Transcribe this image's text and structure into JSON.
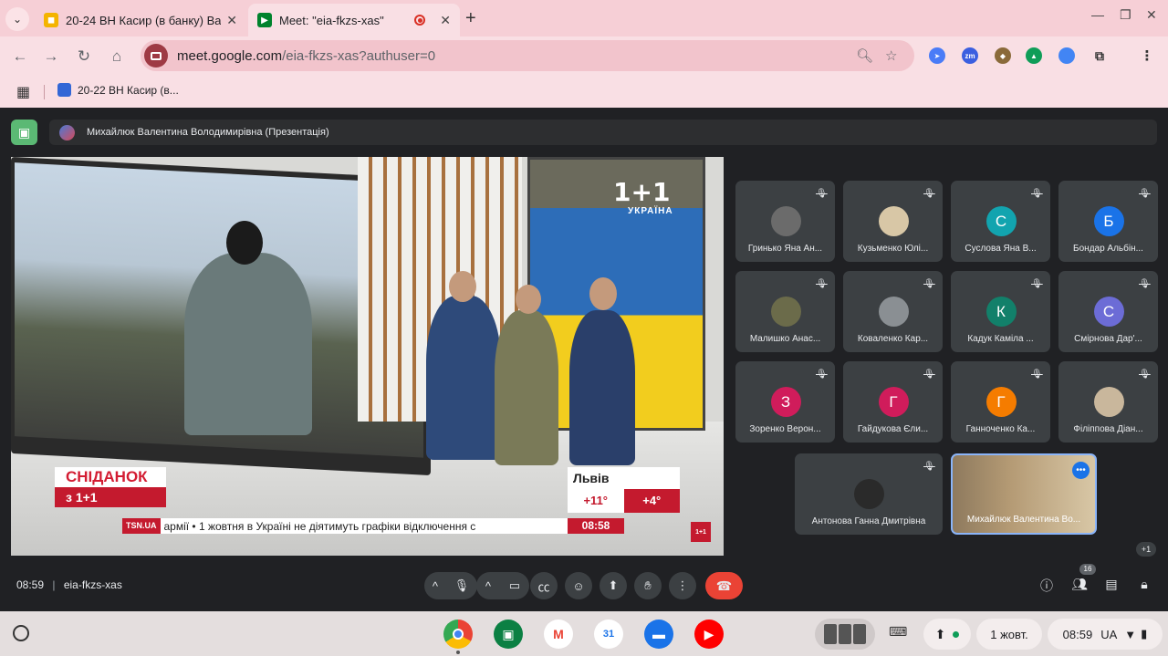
{
  "browser": {
    "tabs": [
      {
        "title": "20-24 ВН Касир (в банку) Вал",
        "active": false
      },
      {
        "title": "Meet: \"eia-fkzs-xas\"",
        "active": true
      }
    ],
    "url_host": "meet.google.com",
    "url_path": "/eia-fkzs-xas?authuser=0",
    "bookmark": "20-22 ВН Касир (в..."
  },
  "meet": {
    "presenter_banner": "Михайлюк Валентина Володимирівна (Презентація)",
    "broadcast": {
      "channel_logo": "1+1",
      "channel_sub": "УКРАЇНА",
      "show_name": "СНІДАНОК",
      "show_sub": "з 1+1",
      "city": "Львів",
      "temp1": "+11°",
      "temp2": "+4°",
      "ticker_source": "TSN.UA",
      "ticker_text": "армії • 1 жовтня в Україні не діятимуть графіки відключення с",
      "ticker_time": "08:58"
    },
    "participants": [
      {
        "name": "Гринько Яна Ан...",
        "initial": "",
        "color": "#6b6b6b"
      },
      {
        "name": "Кузьменко Юлі...",
        "initial": "",
        "color": "#d8c7a6"
      },
      {
        "name": "Суслова Яна В...",
        "initial": "С",
        "color": "#12a4af"
      },
      {
        "name": "Бондар Альбін...",
        "initial": "Б",
        "color": "#1a73e8"
      },
      {
        "name": "Малишко Анас...",
        "initial": "",
        "color": "#6b6b4a"
      },
      {
        "name": "Коваленко Кар...",
        "initial": "",
        "color": "#8a8f93"
      },
      {
        "name": "Кадук Каміла ...",
        "initial": "К",
        "color": "#12806a"
      },
      {
        "name": "Смірнова Дар'...",
        "initial": "С",
        "color": "#6c6cd6"
      },
      {
        "name": "Зоренко Верон...",
        "initial": "З",
        "color": "#d01c5b"
      },
      {
        "name": "Гайдукова Єли...",
        "initial": "Г",
        "color": "#d01c5b"
      },
      {
        "name": "Ганноченко Ка...",
        "initial": "Г",
        "color": "#f57c00"
      },
      {
        "name": "Філіппова Діан...",
        "initial": "",
        "color": "#c9b79c"
      },
      {
        "name": "Антонова Ганна Дмитрівна",
        "initial": "",
        "color": "#2a2a2a"
      }
    ],
    "self_name": "Михайлюк Валентина Во...",
    "extra_count": "+1",
    "time": "08:59",
    "meeting_code": "eia-fkzs-xas",
    "people_count": "16",
    "colors": {
      "leave": "#ea4335",
      "present": "#5bb974",
      "self_border": "#8ab4f8"
    }
  },
  "shelf": {
    "date": "1 жовт.",
    "time": "08:59",
    "lang": "UA"
  }
}
